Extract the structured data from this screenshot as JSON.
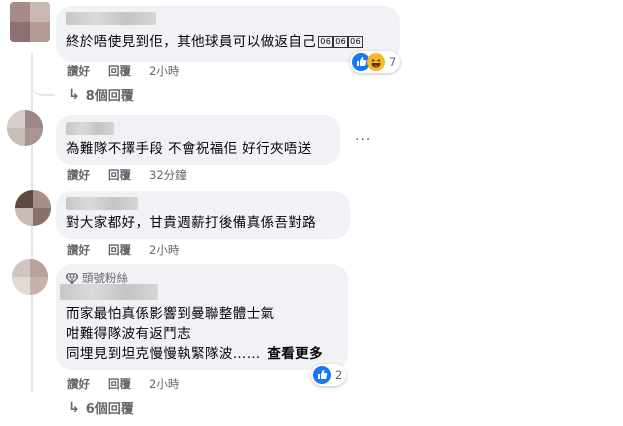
{
  "comments": [
    {
      "text_parts": [
        "終於唔使見到佢，其他球員可以做返自己",
        "06",
        "06",
        "06"
      ],
      "actions": {
        "like": "讚好",
        "reply": "回覆"
      },
      "time": "2小時",
      "reaction_count": "7",
      "reactions": [
        "like-icon",
        "haha-icon"
      ],
      "replies_label": "8個回覆"
    },
    {
      "text": "為難隊不擇手段 不會祝福佢 好行夾唔送",
      "actions": {
        "like": "讚好",
        "reply": "回覆"
      },
      "time": "32分鐘",
      "more": "···"
    },
    {
      "text": "對大家都好，甘貴週薪打後備真係吾對路",
      "actions": {
        "like": "讚好",
        "reply": "回覆"
      },
      "time": "2小時"
    },
    {
      "badge": "頭號粉絲",
      "lines": [
        "而家最怕真係影響到曼聯整體士氣",
        "咁難得隊波有返鬥志",
        "同埋見到坦克慢慢執緊隊波……"
      ],
      "see_more": "查看更多",
      "actions": {
        "like": "讚好",
        "reply": "回覆"
      },
      "time": "2小時",
      "reaction_count": "2",
      "reactions": [
        "like-icon"
      ],
      "replies_label": "6個回覆"
    }
  ],
  "colors": {
    "like_blue": "#1877f2",
    "haha_yellow": "#f7b928",
    "bubble_bg": "#f0f2f5",
    "meta_gray": "#65676b"
  }
}
